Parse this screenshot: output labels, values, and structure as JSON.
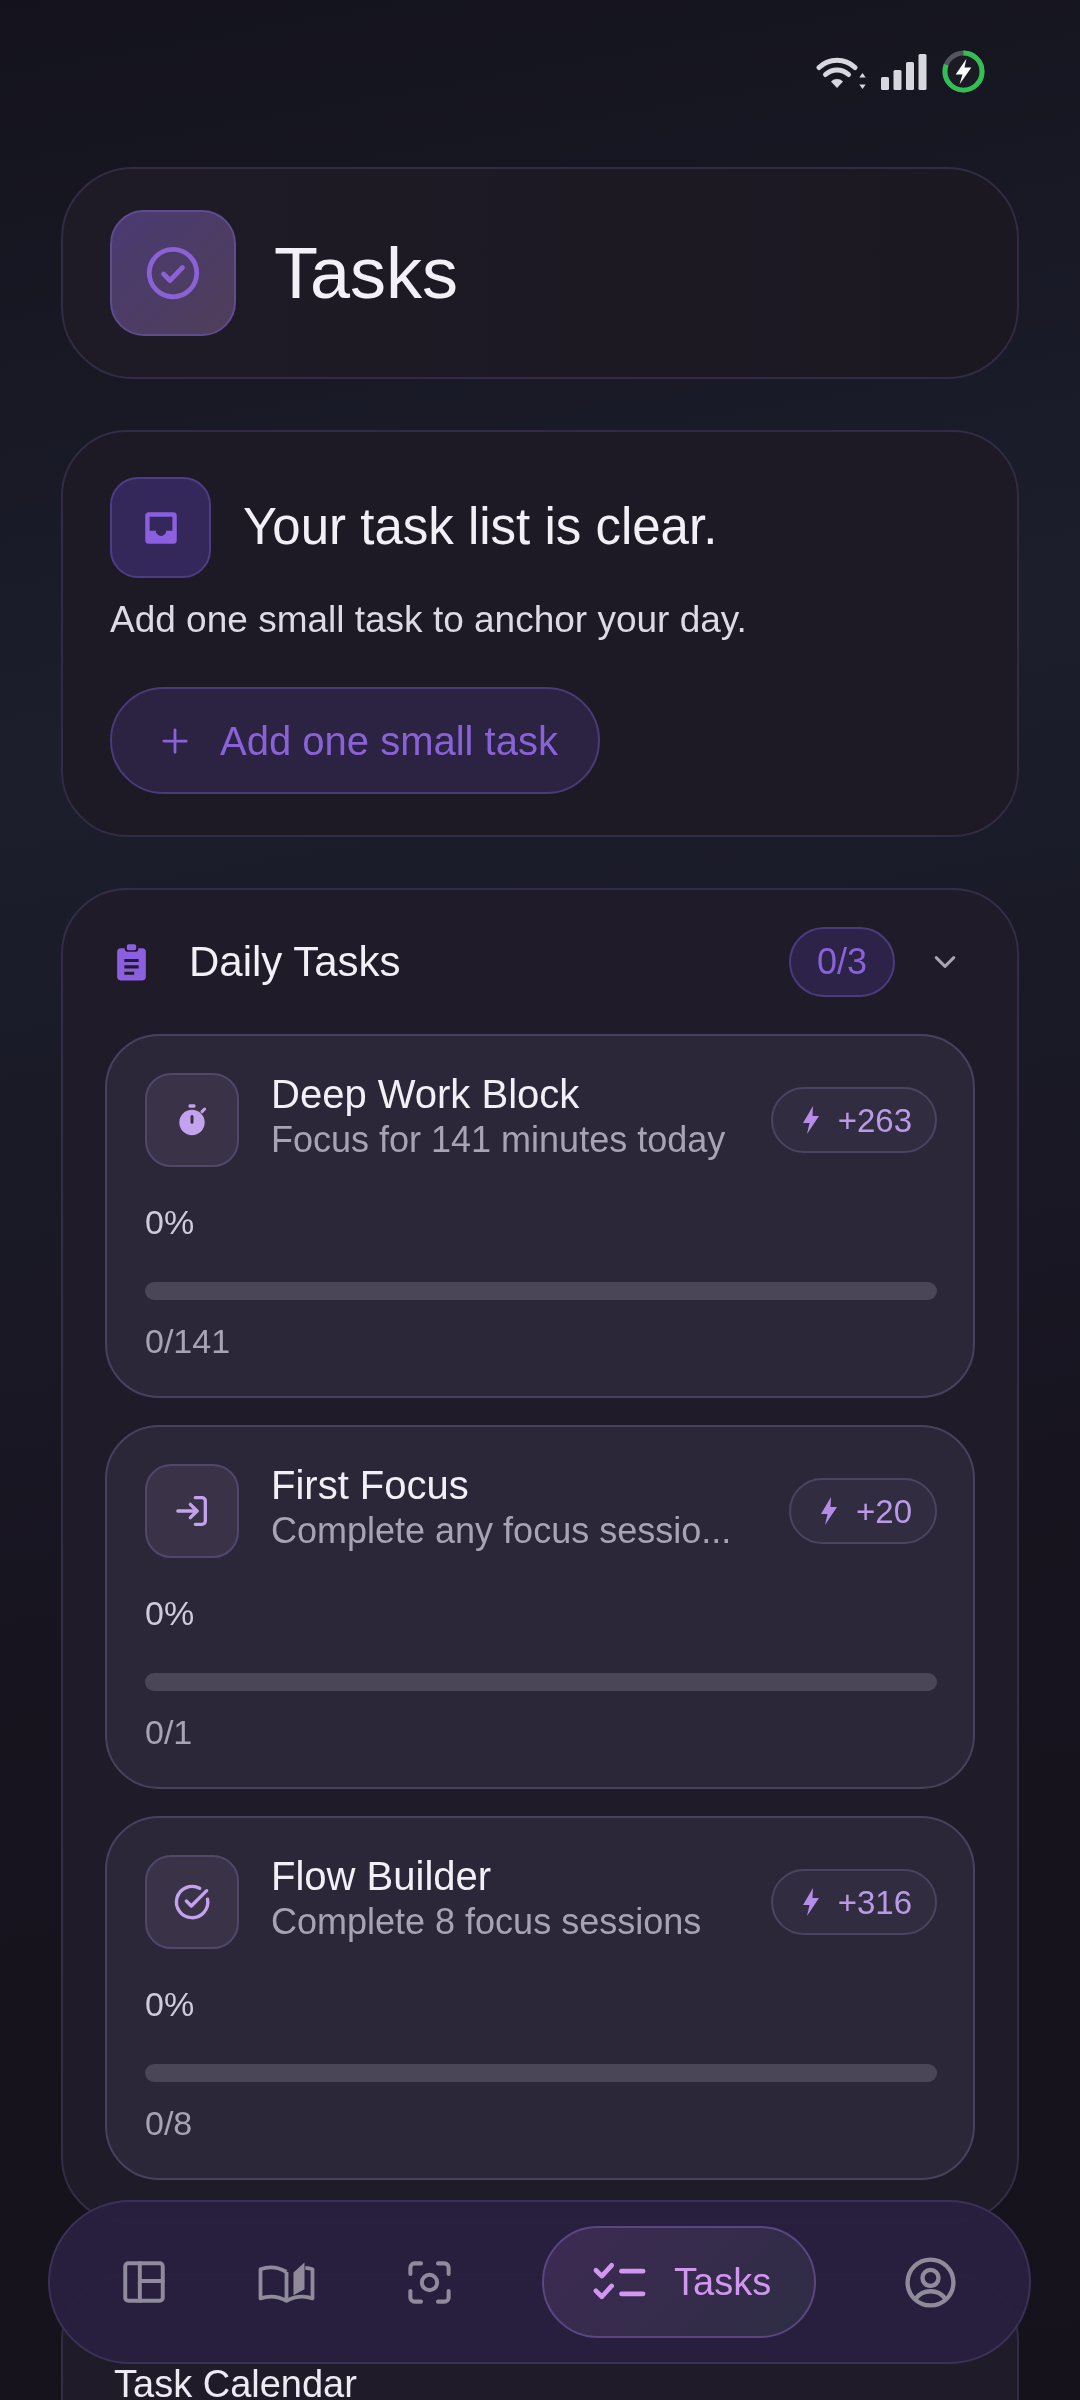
{
  "header": {
    "title": "Tasks"
  },
  "empty_state": {
    "title": "Your task list is clear.",
    "message": "Add one small task to anchor your day.",
    "button": "Add one small task"
  },
  "daily_tasks": {
    "title": "Daily Tasks",
    "count": "0/3",
    "expanded": true,
    "tasks": [
      {
        "kind": "timer",
        "title": "Deep Work Block",
        "description": "Focus for 141 minutes today",
        "reward": "+263",
        "percent": "0%",
        "level": 0,
        "progress": "0/141"
      },
      {
        "kind": "enter",
        "title": "First Focus",
        "description": "Complete any focus sessio...",
        "reward": "+20",
        "percent": "0%",
        "level": 0,
        "progress": "0/1"
      },
      {
        "kind": "check",
        "title": "Flow Builder",
        "description": "Complete 8 focus sessions",
        "reward": "+316",
        "percent": "0%",
        "level": 0,
        "progress": "0/8"
      }
    ]
  },
  "task_calendar": {
    "title": "Task Calendar"
  },
  "nav": {
    "items": [
      {
        "kind": "layout",
        "selected": false
      },
      {
        "kind": "book",
        "selected": false
      },
      {
        "kind": "scan",
        "selected": false
      },
      {
        "kind": "tasks",
        "label": "Tasks",
        "selected": true
      },
      {
        "kind": "profile",
        "selected": false
      }
    ]
  }
}
